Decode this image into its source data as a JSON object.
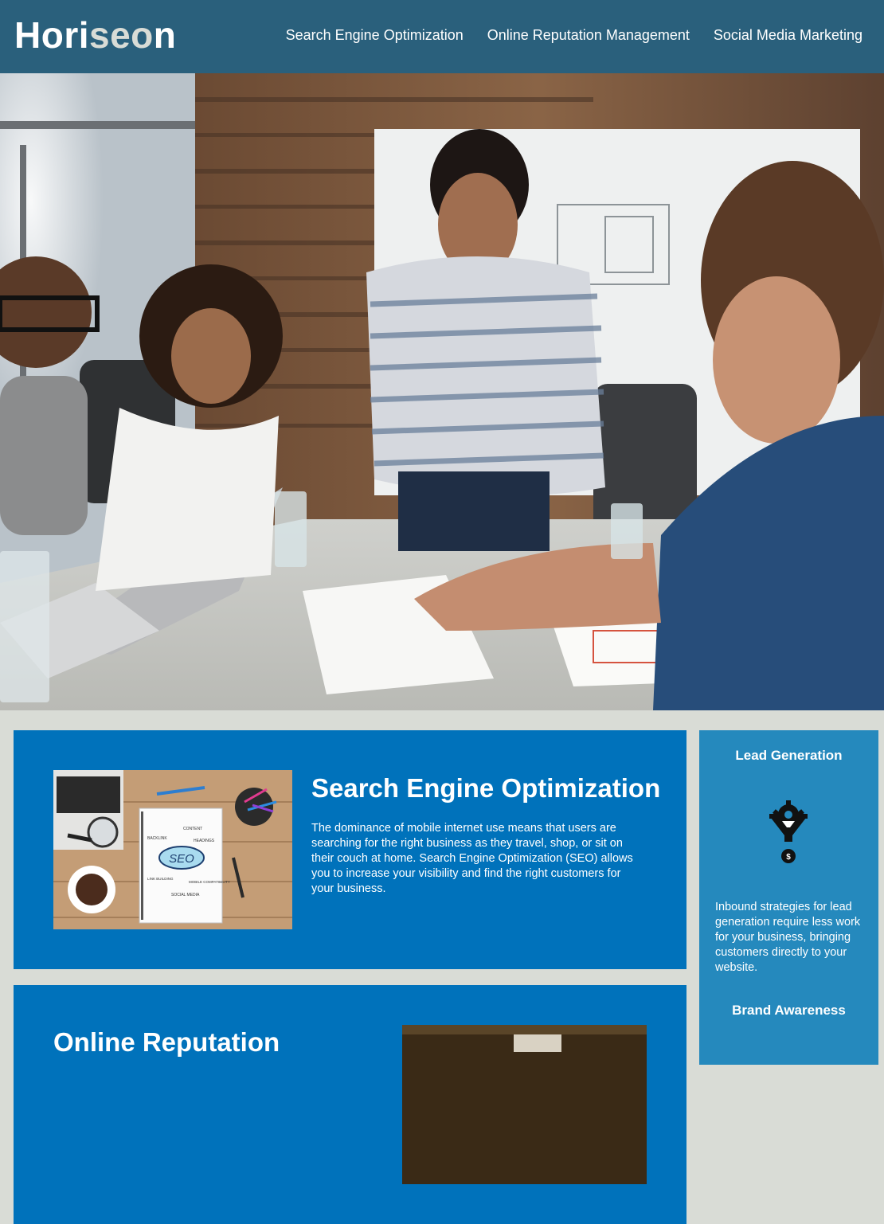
{
  "header": {
    "logo_main": "Hori",
    "logo_accent": "seo",
    "logo_tail": "n",
    "nav": [
      {
        "label": "Search Engine Optimization"
      },
      {
        "label": "Online Reputation Management"
      },
      {
        "label": "Social Media Marketing"
      }
    ]
  },
  "hero": {
    "image": "team-meeting-photo"
  },
  "content": {
    "seo": {
      "title": "Search Engine Optimization",
      "text": "The dominance of mobile internet use means that users are searching for the right business as they travel, shop, or sit on their couch at home. Search Engine Optimization (SEO) allows you to increase your visibility and find the right customers for your business.",
      "image_words": {
        "center": "SEO",
        "content": "CONTENT",
        "backlink": "BACKLINK",
        "headings": "HEADINGS",
        "link_building": "LINK BUILDING",
        "mobile": "MOBILE COMPATIBILITY",
        "social": "SOCIAL MEDIA"
      }
    },
    "orm": {
      "title": "Online Reputation"
    }
  },
  "benefits": {
    "lead": {
      "title": "Lead Generation",
      "icon": "funnel-gear-icon",
      "text": "Inbound strategies for lead generation require less work for your business, bringing customers directly to your website."
    },
    "brand": {
      "title": "Brand Awareness"
    }
  },
  "colors": {
    "header_bg": "#2a607c",
    "page_bg": "#d9dcd6",
    "card_bg": "#0072bb",
    "benefits_bg": "#2589bd"
  }
}
